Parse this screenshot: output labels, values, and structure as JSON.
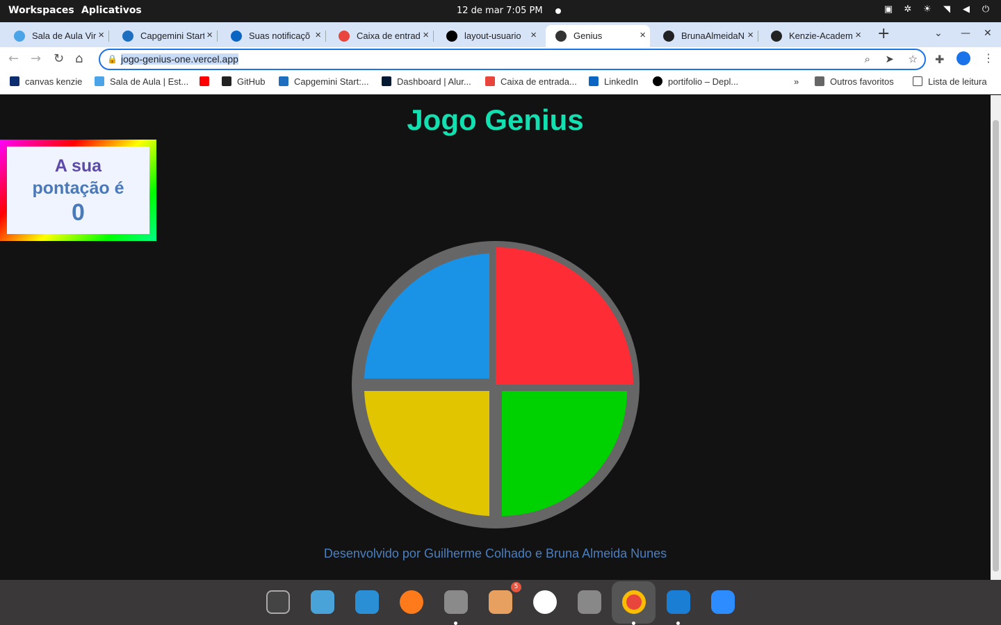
{
  "topbar": {
    "workspaces": "Workspaces",
    "apps": "Aplicativos",
    "clock": "12 de mar   7:05 PM"
  },
  "tabs": [
    {
      "label": "Sala de Aula Vir",
      "color": "#4ba3e8"
    },
    {
      "label": "Capgemini Start",
      "color": "#1e6fc0"
    },
    {
      "label": "Suas notificaçõ",
      "color": "#0a66c2"
    },
    {
      "label": "Caixa de entrad",
      "color": "#e8453c"
    },
    {
      "label": "layout-usuario",
      "color": "#000000"
    },
    {
      "label": "Genius",
      "color": "#333333"
    },
    {
      "label": "BrunaAlmeidaN",
      "color": "#222222"
    },
    {
      "label": "Kenzie-Academ",
      "color": "#222222"
    }
  ],
  "address": {
    "url": "jogo-genius-one.vercel.app"
  },
  "bookmarks": [
    {
      "label": "canvas kenzie",
      "color": "#0d2e6e"
    },
    {
      "label": "Sala de Aula | Est...",
      "color": "#4ba3e8"
    },
    {
      "label": "",
      "color": "#ff0000"
    },
    {
      "label": "GitHub",
      "color": "#222222"
    },
    {
      "label": "Capgemini Start:...",
      "color": "#1e6fc0"
    },
    {
      "label": "Dashboard | Alur...",
      "color": "#051933"
    },
    {
      "label": "Caixa de entrada...",
      "color": "#e8453c"
    },
    {
      "label": "LinkedIn",
      "color": "#0a66c2"
    },
    {
      "label": "portifolio – Depl...",
      "color": "#000000"
    }
  ],
  "bookmarks_more": "»",
  "bookmarks_other": "Outros favoritos",
  "reading_list": "Lista de leitura",
  "game": {
    "title": "Jogo Genius",
    "score_label_1": "A sua",
    "score_label_2": "pontação é",
    "score": "0",
    "footer": "Desenvolvido por Guilherme Colhado e Bruna Almeida Nunes",
    "colors": {
      "blue": "#1a92e6",
      "red": "#fe2c34",
      "yellow": "#e0c500",
      "green": "#00d100",
      "ring": "#666666"
    }
  },
  "dock": {
    "badge": "5"
  }
}
